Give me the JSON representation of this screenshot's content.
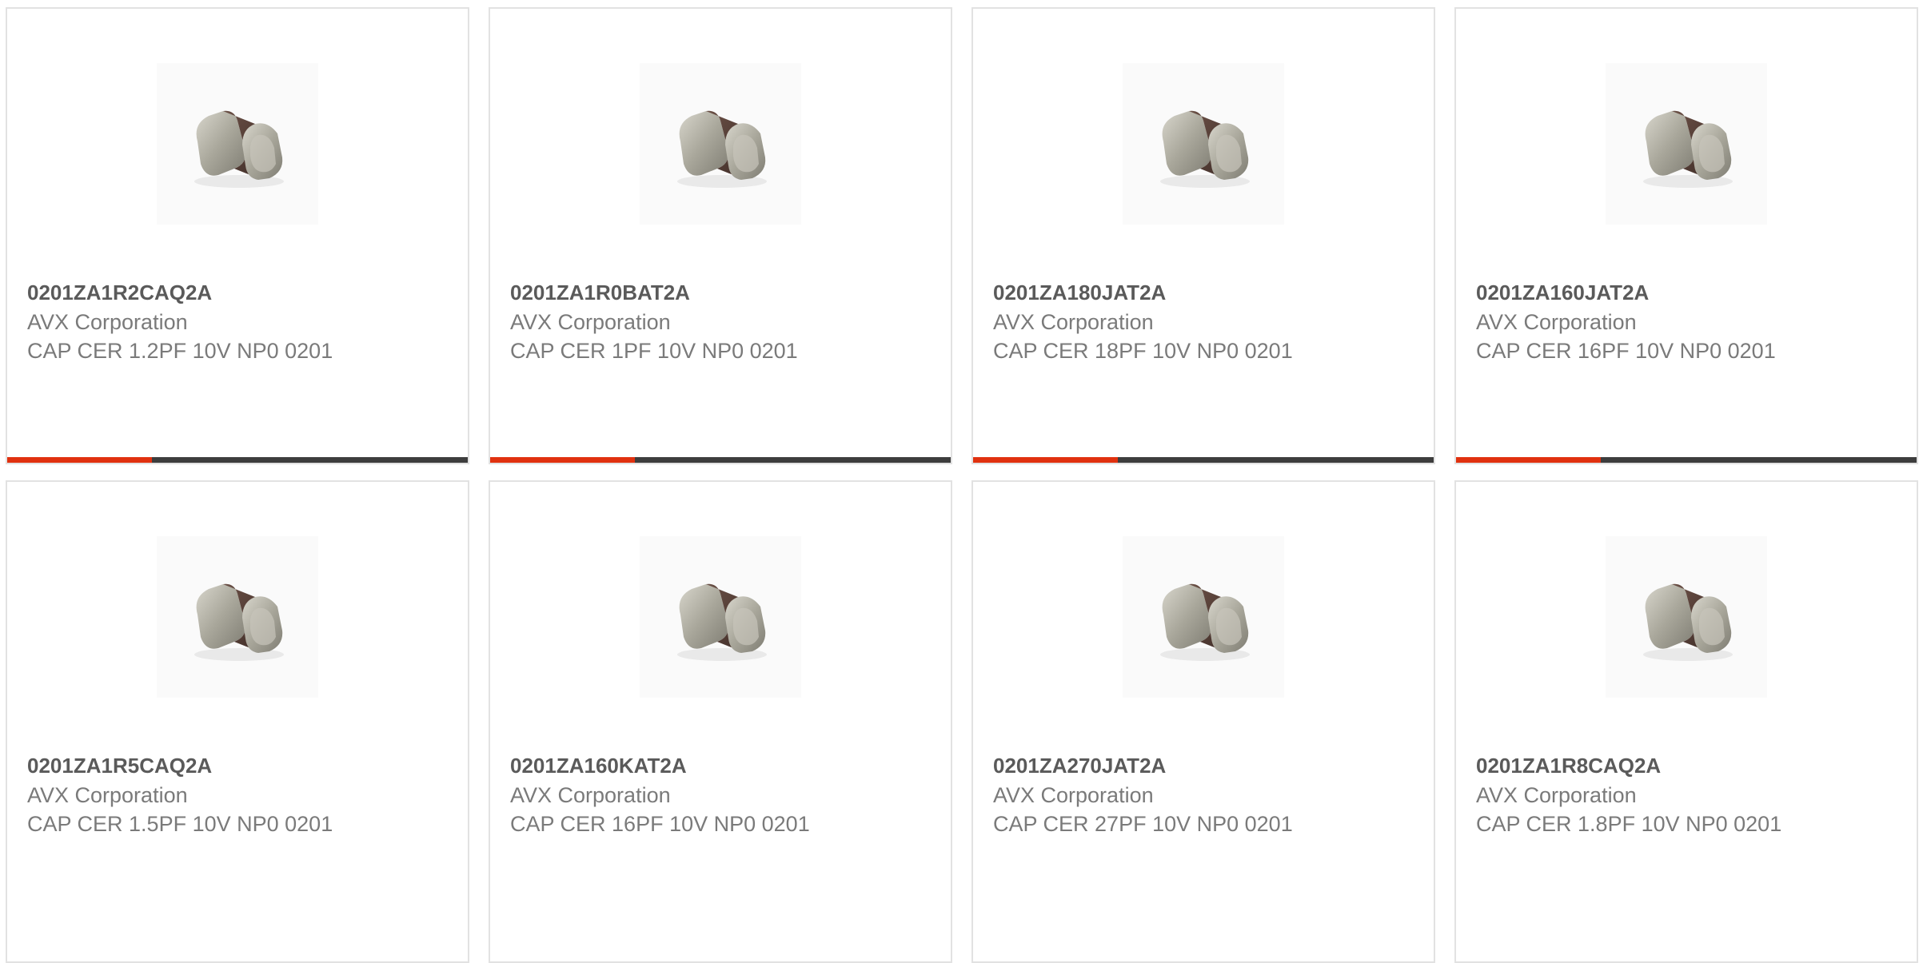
{
  "products": [
    {
      "part_number": "0201ZA1R2CAQ2A",
      "manufacturer": "AVX Corporation",
      "description": "CAP CER 1.2PF 10V NP0 0201",
      "image_icon": "ceramic-capacitor-chip-icon"
    },
    {
      "part_number": "0201ZA1R0BAT2A",
      "manufacturer": "AVX Corporation",
      "description": "CAP CER 1PF 10V NP0 0201",
      "image_icon": "ceramic-capacitor-chip-icon"
    },
    {
      "part_number": "0201ZA180JAT2A",
      "manufacturer": "AVX Corporation",
      "description": "CAP CER 18PF 10V NP0 0201",
      "image_icon": "ceramic-capacitor-chip-icon"
    },
    {
      "part_number": "0201ZA160JAT2A",
      "manufacturer": "AVX Corporation",
      "description": "CAP CER 16PF 10V NP0 0201",
      "image_icon": "ceramic-capacitor-chip-icon"
    },
    {
      "part_number": "0201ZA1R5CAQ2A",
      "manufacturer": "AVX Corporation",
      "description": "CAP CER 1.5PF 10V NP0 0201",
      "image_icon": "ceramic-capacitor-chip-icon"
    },
    {
      "part_number": "0201ZA160KAT2A",
      "manufacturer": "AVX Corporation",
      "description": "CAP CER 16PF 10V NP0 0201",
      "image_icon": "ceramic-capacitor-chip-icon"
    },
    {
      "part_number": "0201ZA270JAT2A",
      "manufacturer": "AVX Corporation",
      "description": "CAP CER 27PF 10V NP0 0201",
      "image_icon": "ceramic-capacitor-chip-icon"
    },
    {
      "part_number": "0201ZA1R8CAQ2A",
      "manufacturer": "AVX Corporation",
      "description": "CAP CER 1.8PF 10V NP0 0201",
      "image_icon": "ceramic-capacitor-chip-icon"
    }
  ],
  "colors": {
    "accent": "#e0310f",
    "bar_dark": "#3d3d3d",
    "card_border": "#e2e2e2",
    "part_text": "#5a5a5a",
    "meta_text": "#7a7a7a"
  },
  "top_row_progress": 0.315
}
